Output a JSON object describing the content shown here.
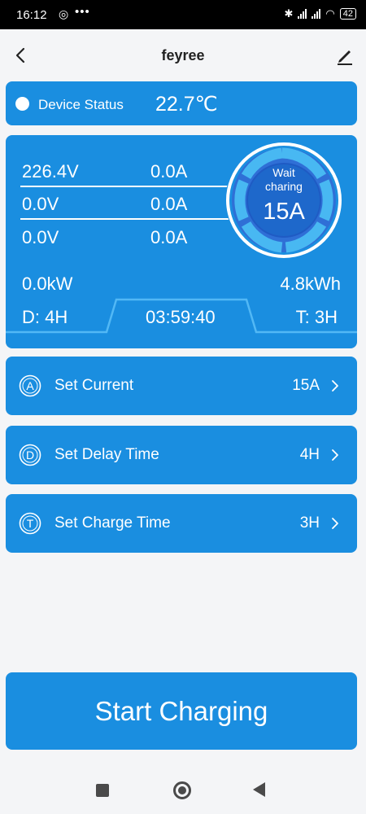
{
  "status_bar": {
    "time": "16:12",
    "battery": "42"
  },
  "header": {
    "title": "feyree"
  },
  "device_status": {
    "label": "Device Status",
    "temperature": "22.7℃"
  },
  "readings": {
    "rows": [
      {
        "voltage": "226.4V",
        "current": "0.0A"
      },
      {
        "voltage": "0.0V",
        "current": "0.0A"
      },
      {
        "voltage": "0.0V",
        "current": "0.0A"
      }
    ],
    "power": "0.0kW",
    "energy": "4.8kWh",
    "delay": "D: 4H",
    "timer": "03:59:40",
    "total": "T: 3H"
  },
  "gauge": {
    "status_line1": "Wait",
    "status_line2": "charing",
    "current": "15A"
  },
  "settings": [
    {
      "icon_letter": "A",
      "label": "Set Current",
      "value": "15A"
    },
    {
      "icon_letter": "D",
      "label": "Set Delay Time",
      "value": "4H"
    },
    {
      "icon_letter": "T",
      "label": "Set Charge Time",
      "value": "3H"
    }
  ],
  "start_button": {
    "label": "Start Charging"
  },
  "colors": {
    "accent": "#1a8ee0",
    "background": "#f4f5f7"
  },
  "icons": [
    "back-arrow-icon",
    "edit-pencil-icon",
    "chevron-right-icon",
    "square-nav-icon",
    "home-nav-icon",
    "back-nav-icon"
  ]
}
